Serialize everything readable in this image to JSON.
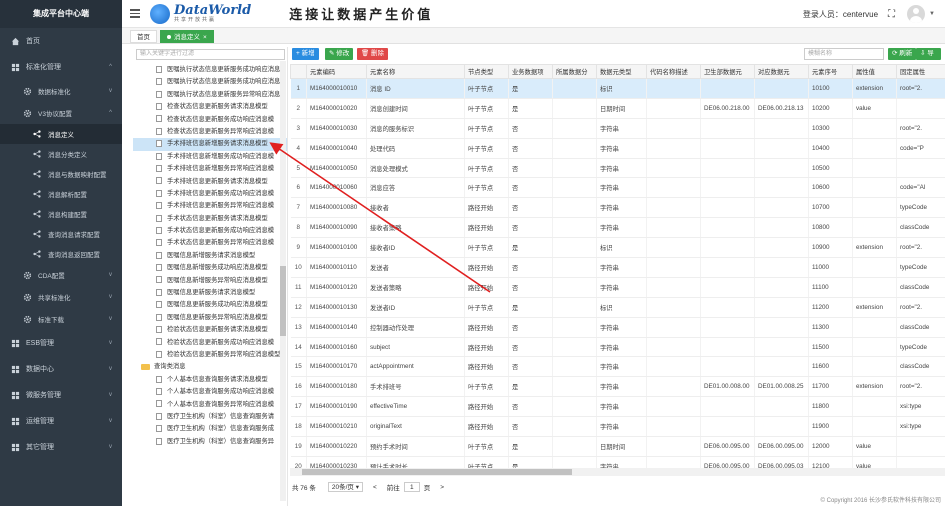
{
  "sidebar": {
    "brand": "集成平台中心端",
    "items": [
      {
        "label": "首页",
        "icon": "home-icon"
      },
      {
        "label": "标准化管理",
        "icon": "grid-icon",
        "arrow": "^"
      },
      {
        "label": "数据标准化",
        "icon": "gear-icon",
        "arrow": "v"
      },
      {
        "label": "V3协议配置",
        "icon": "gear-icon",
        "arrow": "^"
      },
      {
        "label": "消息定义",
        "icon": "share-icon"
      },
      {
        "label": "消息分类定义",
        "icon": "share-icon"
      },
      {
        "label": "消息与数据映射配置",
        "icon": "share-icon"
      },
      {
        "label": "消息解析配置",
        "icon": "share-icon"
      },
      {
        "label": "消息构建配置",
        "icon": "share-icon"
      },
      {
        "label": "查询消息请求配置",
        "icon": "share-icon"
      },
      {
        "label": "查询消息返回配置",
        "icon": "share-icon"
      },
      {
        "label": "CDA配置",
        "icon": "gear-icon",
        "arrow": "v"
      },
      {
        "label": "共享标准化",
        "icon": "gear-icon",
        "arrow": "v"
      },
      {
        "label": "标准下载",
        "icon": "gear-icon",
        "arrow": "v"
      },
      {
        "label": "ESB管理",
        "icon": "grid-icon",
        "arrow": "v"
      },
      {
        "label": "数据中心",
        "icon": "grid-icon",
        "arrow": "v"
      },
      {
        "label": "微服务管理",
        "icon": "grid-icon",
        "arrow": "v"
      },
      {
        "label": "运维管理",
        "icon": "grid-icon",
        "arrow": "v"
      },
      {
        "label": "其它管理",
        "icon": "grid-icon",
        "arrow": "v"
      }
    ]
  },
  "header": {
    "logo_title": "DataWorld",
    "logo_sub": "共享开放共赢",
    "slogan": "连接让数据产生价值",
    "login_prefix": "登录人员：",
    "username": "centervue"
  },
  "tabs": [
    {
      "label": "首页"
    },
    {
      "label": "消息定义",
      "close": "×"
    }
  ],
  "tree": {
    "search_placeholder": "输入关键字进行过滤",
    "items": [
      {
        "label": "医嘱执行状态信息更新服务成功响应消息",
        "type": "file"
      },
      {
        "label": "医嘱执行状态信息更新服务成功响应消息",
        "type": "file"
      },
      {
        "label": "医嘱执行状态信息更新服务异常响应消息",
        "type": "file"
      },
      {
        "label": "检查状态信息更新服务请求消息模型",
        "type": "file"
      },
      {
        "label": "检查状态信息更新服务成功响应消息模",
        "type": "file"
      },
      {
        "label": "检查状态信息更新服务异常响应消息模",
        "type": "file"
      },
      {
        "label": "手术排班信息新增服务请求消息模型",
        "type": "file",
        "selected": true
      },
      {
        "label": "手术排班信息新增服务成功响应消息模",
        "type": "file"
      },
      {
        "label": "手术排班信息新增服务异常响应消息模",
        "type": "file"
      },
      {
        "label": "手术排班信息更新服务请求消息模型",
        "type": "file"
      },
      {
        "label": "手术排班信息更新服务成功响应消息模",
        "type": "file"
      },
      {
        "label": "手术排班信息更新服务异常响应消息模",
        "type": "file"
      },
      {
        "label": "手术状态信息更新服务请求消息模型",
        "type": "file"
      },
      {
        "label": "手术状态信息更新服务成功响应消息模",
        "type": "file"
      },
      {
        "label": "手术状态信息更新服务异常响应消息模",
        "type": "file"
      },
      {
        "label": "医嘱信息新增服务请求消息模型",
        "type": "file"
      },
      {
        "label": "医嘱信息新增服务成功响应消息模型",
        "type": "file"
      },
      {
        "label": "医嘱信息新增服务异常响应消息模型",
        "type": "file"
      },
      {
        "label": "医嘱信息更新服务请求消息模型",
        "type": "file"
      },
      {
        "label": "医嘱信息更新服务成功响应消息模型",
        "type": "file"
      },
      {
        "label": "医嘱信息更新服务异常响应消息模型",
        "type": "file"
      },
      {
        "label": "检验状态信息更新服务请求消息模型",
        "type": "file"
      },
      {
        "label": "检验状态信息更新服务成功响应消息模",
        "type": "file"
      },
      {
        "label": "检验状态信息更新服务异常响应消息模型",
        "type": "file"
      },
      {
        "label": "查询类消息",
        "type": "folder"
      },
      {
        "label": "个人基本信息查询服务请求消息模型",
        "type": "file"
      },
      {
        "label": "个人基本信息查询服务成功响应消息模",
        "type": "file"
      },
      {
        "label": "个人基本信息查询服务异常响应消息模",
        "type": "file"
      },
      {
        "label": "医疗卫生机构（科室）信息查询服务请",
        "type": "file"
      },
      {
        "label": "医疗卫生机构（科室）信息查询服务成",
        "type": "file"
      },
      {
        "label": "医疗卫生机构（科室）信息查询服务异",
        "type": "file"
      }
    ]
  },
  "toolbar": {
    "add": "+ 新增",
    "edit": "✎ 修改",
    "delete": "🗑 删除",
    "search_placeholder": "模糊名称",
    "refresh": "⟳ 刷新",
    "export": "⇩ 导出"
  },
  "table": {
    "headers": [
      "",
      "元素编码",
      "元素名称",
      "节点类型",
      "业务数据项",
      "所属数据分",
      "数据元类型",
      "代码名称描述",
      "卫生部数据元",
      "对应数据元",
      "元素序号",
      "属性值",
      "固定属性"
    ],
    "rows": [
      [
        "1",
        "M164000010010",
        "消息 ID",
        "叶子节点",
        "是",
        "",
        "标识",
        "",
        "",
        "",
        "10100",
        "extension",
        "root=\"2."
      ],
      [
        "2",
        "M164000010020",
        "消息创建时间",
        "叶子节点",
        "是",
        "",
        "日期时间",
        "",
        "DE06.00.218.00",
        "DE06.00.218.13",
        "10200",
        "value",
        ""
      ],
      [
        "3",
        "M164000010030",
        "消息的服务标识",
        "叶子节点",
        "否",
        "",
        "字符串",
        "",
        "",
        "",
        "10300",
        "",
        "root=\"2."
      ],
      [
        "4",
        "M164000010040",
        "处理代码",
        "叶子节点",
        "否",
        "",
        "字符串",
        "",
        "",
        "",
        "10400",
        "",
        "code=\"P"
      ],
      [
        "5",
        "M164000010050",
        "消息处理模式",
        "叶子节点",
        "否",
        "",
        "字符串",
        "",
        "",
        "",
        "10500",
        "",
        ""
      ],
      [
        "6",
        "M164000010060",
        "消息应答",
        "叶子节点",
        "否",
        "",
        "字符串",
        "",
        "",
        "",
        "10600",
        "",
        "code=\"Al"
      ],
      [
        "7",
        "M164000010080",
        "接收者",
        "路径开始",
        "否",
        "",
        "字符串",
        "",
        "",
        "",
        "10700",
        "",
        "typeCode"
      ],
      [
        "8",
        "M164000010090",
        "接收者策略",
        "路径开始",
        "否",
        "",
        "字符串",
        "",
        "",
        "",
        "10800",
        "",
        "classCode"
      ],
      [
        "9",
        "M164000010100",
        "接收者ID",
        "叶子节点",
        "是",
        "",
        "标识",
        "",
        "",
        "",
        "10900",
        "extension",
        "root=\"2."
      ],
      [
        "10",
        "M164000010110",
        "发送者",
        "路径开始",
        "否",
        "",
        "字符串",
        "",
        "",
        "",
        "11000",
        "",
        "typeCode"
      ],
      [
        "11",
        "M164000010120",
        "发送者策略",
        "路径开始",
        "否",
        "",
        "字符串",
        "",
        "",
        "",
        "11100",
        "",
        "classCode"
      ],
      [
        "12",
        "M164000010130",
        "发送者ID",
        "叶子节点",
        "是",
        "",
        "标识",
        "",
        "",
        "",
        "11200",
        "extension",
        "root=\"2."
      ],
      [
        "13",
        "M164000010140",
        "控制器动作处理",
        "路径开始",
        "否",
        "",
        "字符串",
        "",
        "",
        "",
        "11300",
        "",
        "classCode"
      ],
      [
        "14",
        "M164000010160",
        "subject",
        "路径开始",
        "否",
        "",
        "字符串",
        "",
        "",
        "",
        "11500",
        "",
        "typeCode"
      ],
      [
        "15",
        "M164000010170",
        "actAppointment",
        "路径开始",
        "否",
        "",
        "字符串",
        "",
        "",
        "",
        "11600",
        "",
        "classCode"
      ],
      [
        "16",
        "M164000010180",
        "手术排班号",
        "叶子节点",
        "是",
        "",
        "字符串",
        "",
        "DE01.00.008.00",
        "DE01.00.008.25",
        "11700",
        "extension",
        "root=\"2."
      ],
      [
        "17",
        "M164000010190",
        "effectiveTime",
        "路径开始",
        "否",
        "",
        "字符串",
        "",
        "",
        "",
        "11800",
        "",
        "xsi:type"
      ],
      [
        "18",
        "M164000010210",
        "originalText",
        "路径开始",
        "否",
        "",
        "字符串",
        "",
        "",
        "",
        "11900",
        "",
        "xsi:type"
      ],
      [
        "19",
        "M164000010220",
        "预约手术时间",
        "叶子节点",
        "是",
        "",
        "日期时间",
        "",
        "DE06.00.095.00",
        "DE06.00.095.00",
        "12000",
        "value",
        ""
      ],
      [
        "20",
        "M164000010230",
        "预计手术时长",
        "叶子节点",
        "是",
        "",
        "字符串",
        "",
        "DE06.00.095.00",
        "DE06.00.095.03",
        "12100",
        "value",
        ""
      ]
    ]
  },
  "pager": {
    "total": "共 76 条",
    "page_size": "20条/页",
    "prev": "<",
    "goto_label": "前往",
    "page": "1",
    "page_suffix": "页",
    "next": ">"
  },
  "footer": "© Copyright 2016 长沙参氏软件科技有限公司",
  "colors": {
    "sidebar_bg": "#2f3a45",
    "accent_green": "#3aa64d",
    "accent_blue": "#2a8ce0",
    "danger_red": "#e04848",
    "arrow_red": "#e02020"
  }
}
